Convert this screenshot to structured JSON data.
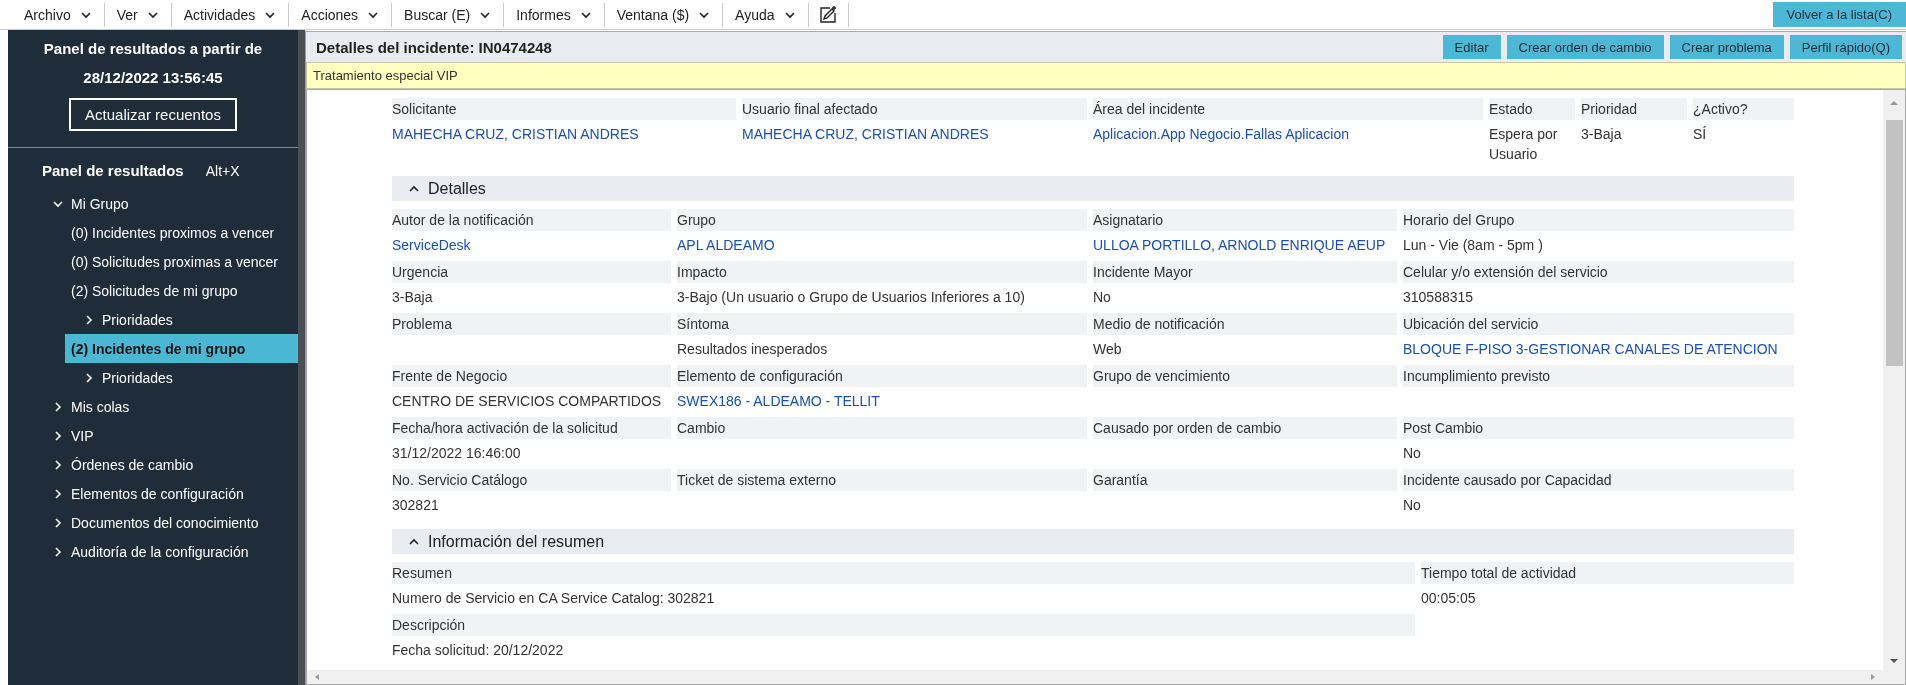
{
  "menu": [
    {
      "label": "Archivo"
    },
    {
      "label": "Ver"
    },
    {
      "label": "Actividades"
    },
    {
      "label": "Acciones"
    },
    {
      "label": "Buscar (E)"
    },
    {
      "label": "Informes"
    },
    {
      "label": "Ventana ($)"
    },
    {
      "label": "Ayuda"
    }
  ],
  "back_button": "Volver a la lista(C)",
  "sidebar": {
    "title_lines": [
      "Panel de resultados a partir de",
      "28/12/2022 13:56:45"
    ],
    "refresh_button": "Actualizar recuentos",
    "panel_title": "Panel de resultados",
    "shortcut": "Alt+X",
    "tree": [
      {
        "label": "Mi Grupo",
        "expanded": true,
        "selected": false,
        "children": [
          {
            "label": "(0) Incidentes proximos a vencer",
            "selected": false
          },
          {
            "label": "(0) Solicitudes proximas a vencer",
            "selected": false
          },
          {
            "label": "(2) Solicitudes de mi grupo",
            "selected": false,
            "children": [
              {
                "label": "Prioridades",
                "expanded": false,
                "selected": false
              }
            ]
          },
          {
            "label": "(2) Incidentes de mi grupo",
            "selected": true,
            "children": [
              {
                "label": "Prioridades",
                "expanded": false,
                "selected": false
              }
            ]
          }
        ]
      },
      {
        "label": "Mis colas",
        "expanded": false,
        "selected": false
      },
      {
        "label": "VIP",
        "expanded": false,
        "selected": false
      },
      {
        "label": "Órdenes de cambio",
        "expanded": false,
        "selected": false
      },
      {
        "label": "Elementos de configuración",
        "expanded": false,
        "selected": false
      },
      {
        "label": "Documentos del conocimiento",
        "expanded": false,
        "selected": false
      },
      {
        "label": "Auditoría de la configuración",
        "expanded": false,
        "selected": false
      }
    ]
  },
  "detail": {
    "title": "Detalles del incidente: IN0474248",
    "buttons": [
      "Editar",
      "Crear orden de cambio",
      "Crear problema",
      "Perfil rápido(Q)"
    ],
    "banner": "Tratamiento especial VIP",
    "summary_fields": [
      {
        "label": "Solicitante",
        "value": "MAHECHA CRUZ, CRISTIAN ANDRES",
        "link": true
      },
      {
        "label": "Usuario final afectado",
        "value": "MAHECHA CRUZ, CRISTIAN ANDRES",
        "link": true
      },
      {
        "label": "Área del incidente",
        "value": "Aplicacion.App Negocio.Fallas Aplicacion",
        "link": true
      },
      {
        "label": "Estado",
        "value": "Espera por Usuario",
        "link": false
      },
      {
        "label": "Prioridad",
        "value": "3-Baja",
        "link": false
      },
      {
        "label": "¿Activo?",
        "value": "SÍ",
        "link": false
      }
    ],
    "sections": [
      {
        "title": "Detalles",
        "expanded": true,
        "kind": "details",
        "fields": [
          {
            "label": "Autor de la notificación",
            "value": "ServiceDesk",
            "link": true
          },
          {
            "label": "Grupo",
            "value": "APL ALDEAMO",
            "link": true
          },
          {
            "label": "Asignatario",
            "value": "ULLOA PORTILLO, ARNOLD ENRIQUE AEUP",
            "link": true
          },
          {
            "label": "Horario del Grupo",
            "value": "Lun - Vie (8am - 5pm )",
            "link": false
          },
          {
            "label": "Urgencia",
            "value": "3-Baja",
            "link": false
          },
          {
            "label": "Impacto",
            "value": "3-Bajo (Un usuario o Grupo de Usuarios Inferiores a 10)",
            "link": false
          },
          {
            "label": "Incidente Mayor",
            "value": "No",
            "link": false
          },
          {
            "label": "Celular y/o extensión del servicio",
            "value": "310588315",
            "link": false
          },
          {
            "label": "Problema"
          },
          {
            "label": "Síntoma",
            "value": "Resultados inesperados",
            "link": false
          },
          {
            "label": "Medio de notificación",
            "value": "Web",
            "link": false
          },
          {
            "label": "Ubicación del servicio",
            "value": "BLOQUE F-PISO 3-GESTIONAR CANALES DE ATENCION",
            "link": true
          },
          {
            "label": "Frente de Negocio",
            "value": "CENTRO DE SERVICIOS COMPARTIDOS",
            "link": false
          },
          {
            "label": "Elemento de configuración",
            "value": "SWEX186 - ALDEAMO - TELLIT",
            "link": true
          },
          {
            "label": "Grupo de vencimiento"
          },
          {
            "label": "Incumplimiento previsto"
          },
          {
            "label": "Fecha/hora activación de la solicitud",
            "value": "31/12/2022 16:46:00",
            "link": false
          },
          {
            "label": "Cambio"
          },
          {
            "label": "Causado por orden de cambio"
          },
          {
            "label": "Post Cambio",
            "value": "No",
            "link": false
          },
          {
            "label": "No. Servicio Catálogo",
            "value": "302821",
            "link": false
          },
          {
            "label": "Ticket de sistema externo"
          },
          {
            "label": "Garantía"
          },
          {
            "label": "Incidente causado por Capacidad",
            "value": "No",
            "link": false
          }
        ]
      },
      {
        "title": "Información del resumen",
        "expanded": true,
        "kind": "summary",
        "fields": [
          {
            "label": "Resumen",
            "value": "Numero de Servicio en CA Service Catalog: 302821",
            "link": false
          },
          {
            "label": "Tiempo total de actividad",
            "value": "00:05:05",
            "link": false
          },
          {
            "label": "Descripción",
            "value": "Fecha solicitud: 20/12/2022",
            "link": false
          }
        ]
      }
    ]
  }
}
